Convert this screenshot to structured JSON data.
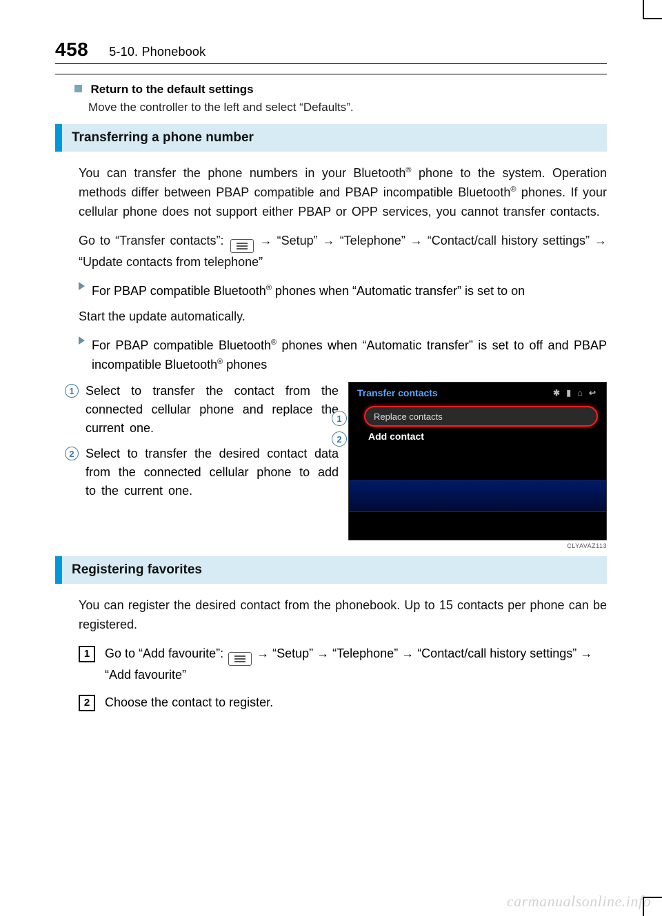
{
  "page": {
    "num": "458",
    "chapter": "5-10. Phonebook"
  },
  "defaults": {
    "heading": "Return to the default settings",
    "text": "Move the controller to the left and select “Defaults”."
  },
  "transfer": {
    "title": "Transferring a phone number",
    "p1a": "You can transfer the phone numbers in your Bluetooth",
    "p1b": " phone to the system. Operation methods differ between PBAP compatible and PBAP incompatible Bluetooth",
    "p1c": " phones. If your cellular phone does not support either PBAP or OPP services, you cannot transfer contacts.",
    "p2a": "Go to “Transfer contacts”: ",
    "p2b": " → “Setup” → “Telephone” → “Contact/call his­tory settings” → “Update contacts from telephone”",
    "b1a": "For PBAP compatible Bluetooth",
    "b1b": " phones when “Automatic transfer” is set to on",
    "p3": "Start the update automatically.",
    "b2a": "For PBAP compatible Bluetooth",
    "b2b": " phones when “Automatic transfer” is set to off and PBAP incompatible Bluetooth",
    "b2c": " phones",
    "n1": "Select to transfer the contact from the connected cellular phone and replace the current one.",
    "n2": "Select to transfer the desired con­tact data from the connected cellu­lar phone to add to the current one."
  },
  "screenshot": {
    "title": "Transfer contacts",
    "row1": "Replace contacts",
    "row2": "Add contact",
    "caption": "CLYAVAZ113",
    "c1": "1",
    "c2": "2"
  },
  "favorites": {
    "title": "Registering favorites",
    "intro": "You can register the desired contact from the phonebook. Up to 15 contacts per phone can be registered.",
    "s1a": "Go to “Add favourite”: ",
    "s1b": " → “Setup” → “Telephone” → “Contact/call his­tory settings” → “Add favourite”",
    "s2": "Choose the contact to register."
  },
  "marks": {
    "step1": "1",
    "step2": "2",
    "reg": "®"
  },
  "watermark": "carmanualsonline.info"
}
